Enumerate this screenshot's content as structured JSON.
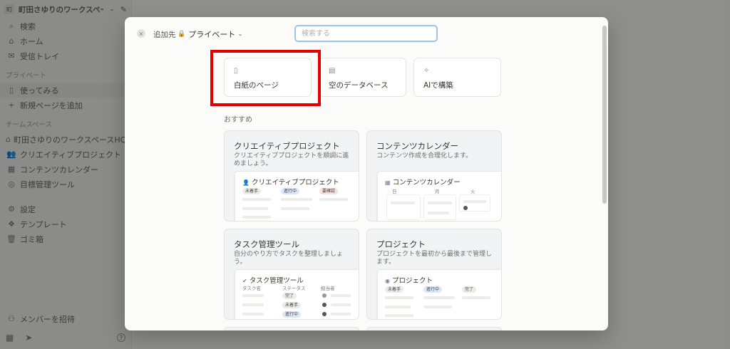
{
  "sidebar": {
    "workspace_logo": "町",
    "workspace_name": "町田さゆりのワークスペース",
    "nav": [
      {
        "icon": "search-icon",
        "label": "検索"
      },
      {
        "icon": "home-icon",
        "label": "ホーム"
      },
      {
        "icon": "inbox-icon",
        "label": "受信トレイ"
      }
    ],
    "private_section": "プライベート",
    "private_items": [
      {
        "icon": "page-icon",
        "label": "使ってみる"
      },
      {
        "icon": "plus-icon",
        "label": "新規ページを追加"
      }
    ],
    "team_section": "チームスペース",
    "team_items": [
      {
        "icon": "home-icon",
        "label": "町田さゆりのワークスペースHQ"
      },
      {
        "icon": "users-icon",
        "label": "クリエイティブプロジェクト"
      },
      {
        "icon": "calendar-icon",
        "label": "コンテンツカレンダー"
      },
      {
        "icon": "target-icon",
        "label": "目標管理ツール"
      }
    ],
    "bottom_items": [
      {
        "icon": "gear-icon",
        "label": "設定"
      },
      {
        "icon": "template-icon",
        "label": "テンプレート"
      },
      {
        "icon": "trash-icon",
        "label": "ゴミ箱"
      }
    ],
    "invite_label": "メンバーを招待",
    "help_label": "?"
  },
  "modal": {
    "close_glyph": "×",
    "add_to_label": "追加先",
    "privacy_label": "プライベート",
    "search_placeholder": "検索する",
    "options": [
      {
        "icon": "page-icon",
        "label": "白紙のページ"
      },
      {
        "icon": "table-icon",
        "label": "空のデータベース"
      },
      {
        "icon": "ai-icon",
        "label": "AIで構築"
      }
    ],
    "recommended_label": "おすすめ",
    "templates": [
      {
        "title": "クリエイティブプロジェクト",
        "description": "クリエイティブプロジェクトを順調に進めましょう。",
        "preview_title": "クリエイティブプロジェクト",
        "tags": [
          "未着手",
          "進行中",
          "要確認"
        ]
      },
      {
        "title": "コンテンツカレンダー",
        "description": "コンテンツ作成を合理化します。",
        "preview_title": "コンテンツカレンダー",
        "days": [
          "日",
          "月",
          "火"
        ]
      },
      {
        "title": "タスク管理ツール",
        "description": "自分のやり方でタスクを整理しましょう。",
        "preview_title": "タスク管理ツール",
        "columns": [
          "タスク名",
          "ステータス",
          "担当者"
        ],
        "tags": [
          "完了",
          "未着手",
          "進行中"
        ]
      },
      {
        "title": "プロジェクト",
        "description": "プロジェクトを最初から最後まで管理します。",
        "preview_title": "プロジェクト",
        "tags": [
          "未着手",
          "進行中",
          "完了"
        ]
      }
    ]
  }
}
